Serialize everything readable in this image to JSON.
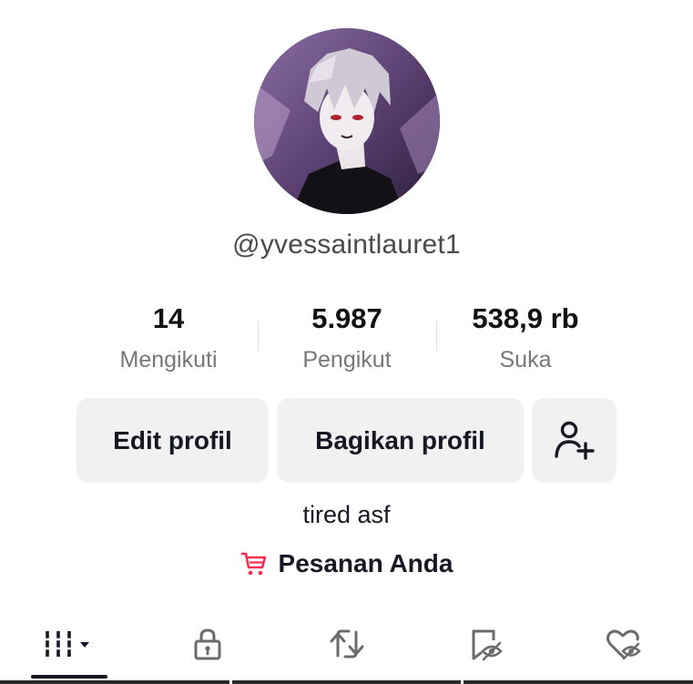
{
  "profile": {
    "username": "@yvessaintlauret1",
    "bio": "tired asf"
  },
  "stats": [
    {
      "value": "14",
      "label": "Mengikuti"
    },
    {
      "value": "5.987",
      "label": "Pengikut"
    },
    {
      "value": "538,9 rb",
      "label": "Suka"
    }
  ],
  "actions": {
    "edit_label": "Edit profil",
    "share_label": "Bagikan profil",
    "add_friend_icon": "person-add-icon"
  },
  "orders": {
    "label": "Pesanan Anda",
    "icon": "cart-icon",
    "icon_color": "#fe2c55"
  },
  "tabs": [
    {
      "icon": "grid-dropdown-icon",
      "selected": true
    },
    {
      "icon": "lock-icon",
      "selected": false
    },
    {
      "icon": "repost-icon",
      "selected": false
    },
    {
      "icon": "bookmark-hidden-icon",
      "selected": false
    },
    {
      "icon": "heart-hidden-icon",
      "selected": false
    }
  ]
}
